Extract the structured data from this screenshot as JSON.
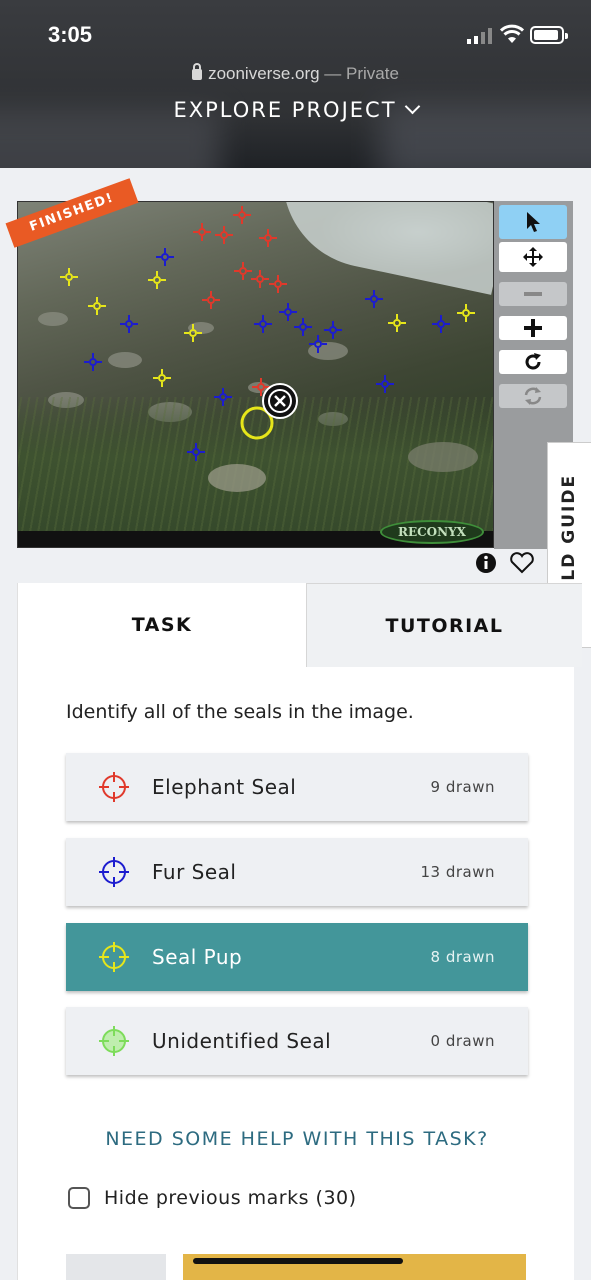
{
  "status_bar": {
    "time": "3:05"
  },
  "browser": {
    "domain": "zooniverse.org",
    "mode": " — Private"
  },
  "nav": {
    "explore_label": "EXPLORE PROJECT"
  },
  "subject": {
    "badge": "FINISHED!",
    "camera_brand": "RECONYX"
  },
  "tools": [
    "pointer-icon",
    "move-icon",
    "zoom-out-icon",
    "zoom-in-icon",
    "rotate-icon",
    "reset-icon"
  ],
  "field_guide_label": "FIELD GUIDE",
  "tabs": {
    "task": "TASK",
    "tutorial": "TUTORIAL"
  },
  "task": {
    "instruction": "Identify all of the seals in the image.",
    "choices": [
      {
        "label": "Elephant Seal",
        "count": "9 drawn",
        "color": "#e0392b"
      },
      {
        "label": "Fur Seal",
        "count": "13 drawn",
        "color": "#1c1ccf"
      },
      {
        "label": "Seal Pup",
        "count": "8 drawn",
        "color": "#e6e61a"
      },
      {
        "label": "Unidentified Seal",
        "count": "0 drawn",
        "color": "#7ddc5a"
      }
    ],
    "help": "NEED SOME HELP WITH THIS TASK?",
    "hide_marks": "Hide previous marks (30)"
  },
  "colors": {
    "selected": "#43969a",
    "badge": "#e95a24",
    "active_tool": "#8fd0f4",
    "help_link": "#2d6b80"
  }
}
